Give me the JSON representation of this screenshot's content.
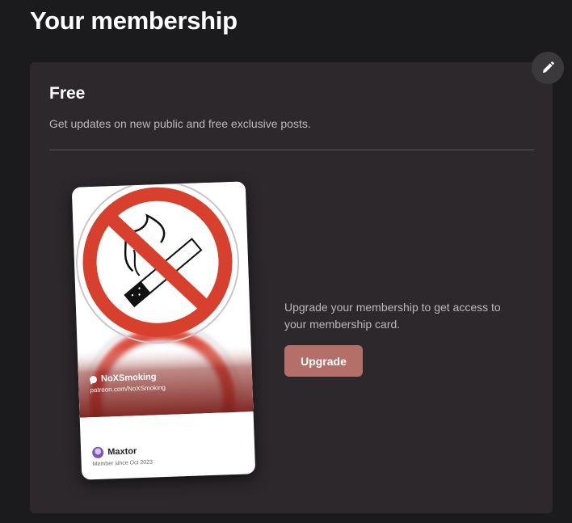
{
  "page": {
    "title": "Your membership"
  },
  "membership": {
    "tier_name": "Free",
    "tier_description": "Get updates on new public and free exclusive posts.",
    "upgrade_text": "Upgrade your membership to get access to your membership card.",
    "upgrade_label": "Upgrade",
    "edit_icon": "pencil-icon"
  },
  "card": {
    "creator_name": "NoXSmoking",
    "creator_url": "patreon.com/NoXSmoking",
    "member_name": "Maxtor",
    "member_since": "Member since Oct 2023",
    "artwork": "no-smoking-sign",
    "sign_color": "#d8402e"
  },
  "colors": {
    "background": "#1b1a1c",
    "panel": "#2c282c",
    "accent": "#b46f69"
  }
}
